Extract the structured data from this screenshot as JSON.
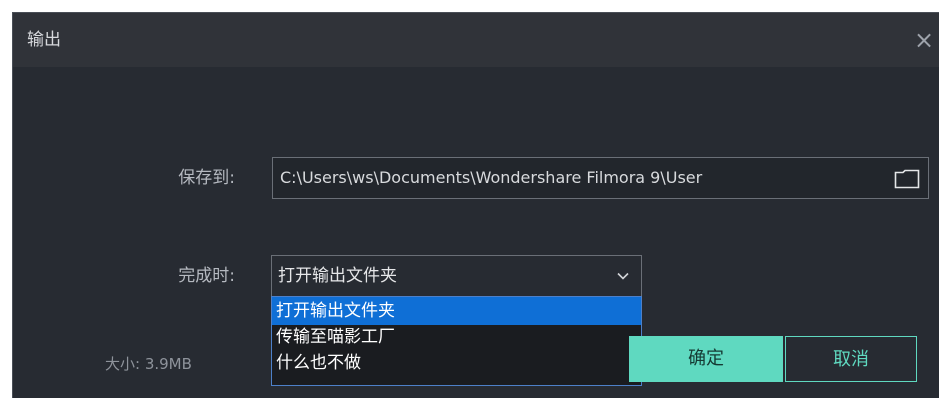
{
  "dialog": {
    "title": "输出",
    "close_glyph": "×"
  },
  "save_to": {
    "label": "保存到:",
    "path": "C:\\Users\\ws\\Documents\\Wondershare Filmora 9\\User",
    "icon": "folder-icon"
  },
  "on_complete": {
    "label": "完成时:",
    "selected": "打开输出文件夹",
    "options": [
      "打开输出文件夹",
      "传输至喵影工厂",
      "什么也不做"
    ]
  },
  "size": {
    "text": "大小: 3.9MB"
  },
  "buttons": {
    "ok": "确定",
    "cancel": "取消"
  },
  "colors": {
    "accent": "#5fd9c0",
    "selection": "#0f6fd6",
    "background": "#272b32"
  }
}
